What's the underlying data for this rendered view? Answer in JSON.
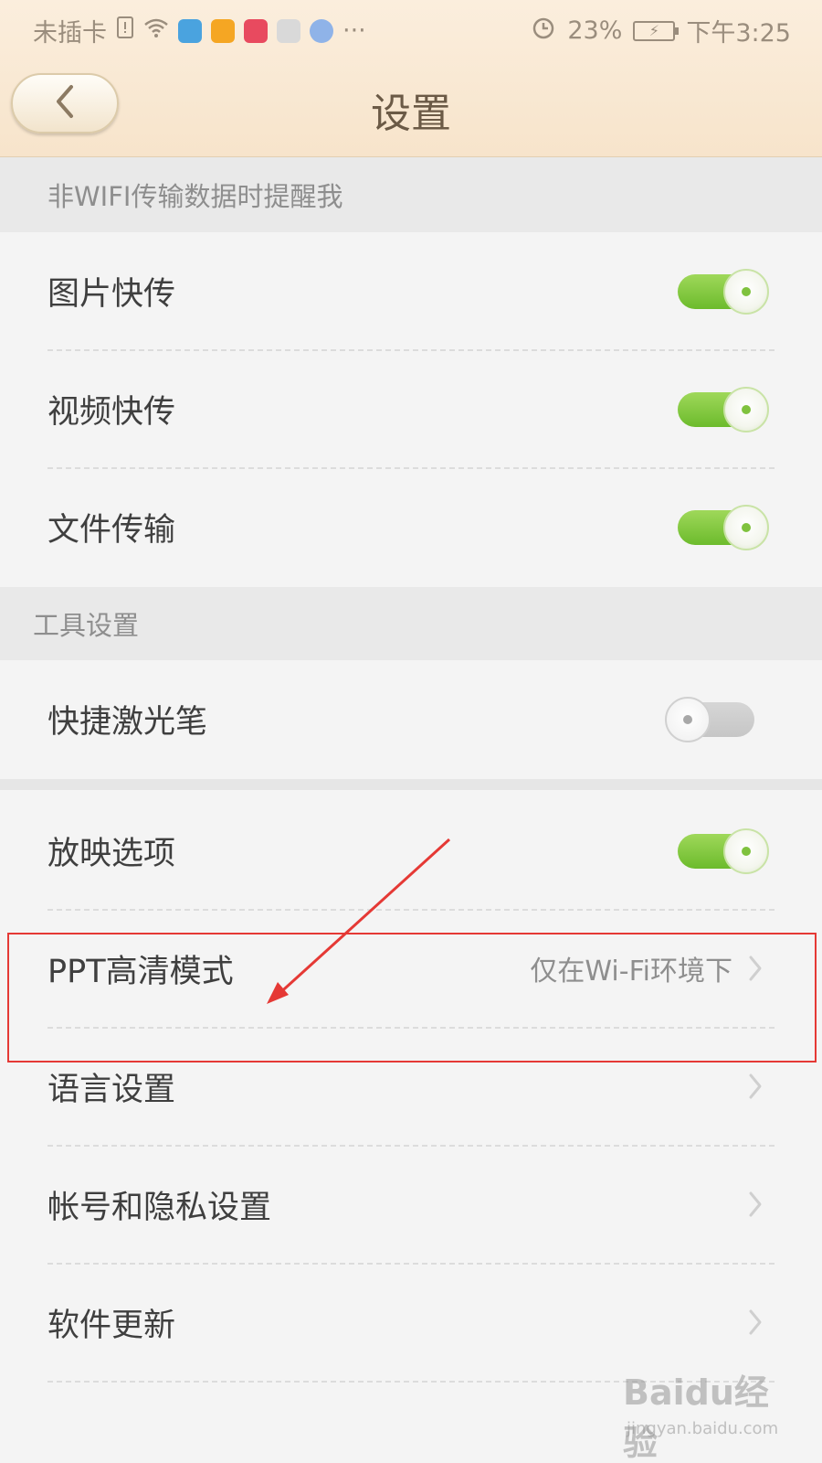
{
  "status_bar": {
    "carrier": "未插卡",
    "more": "···",
    "battery_percent": "23%",
    "time": "下午3:25"
  },
  "header": {
    "title": "设置"
  },
  "sections": {
    "network": {
      "title": "非WIFI传输数据时提醒我",
      "items": [
        {
          "label": "图片快传",
          "toggle": true
        },
        {
          "label": "视频快传",
          "toggle": true
        },
        {
          "label": "文件传输",
          "toggle": true
        }
      ]
    },
    "tools": {
      "title": "工具设置",
      "items": [
        {
          "label": "快捷激光笔",
          "toggle": false
        }
      ]
    },
    "general": {
      "items": [
        {
          "label": "放映选项",
          "toggle": true
        },
        {
          "label": "PPT高清模式",
          "value": "仅在Wi-Fi环境下"
        },
        {
          "label": "语言设置"
        },
        {
          "label": "帐号和隐私设置"
        },
        {
          "label": "软件更新"
        }
      ]
    }
  },
  "watermark": {
    "brand": "Baidu经验",
    "url": "jingyan.baidu.com"
  },
  "colors": {
    "accent_green": "#7fc23e",
    "header_bg": "#f7e4cb",
    "annotation_red": "#e53935"
  }
}
